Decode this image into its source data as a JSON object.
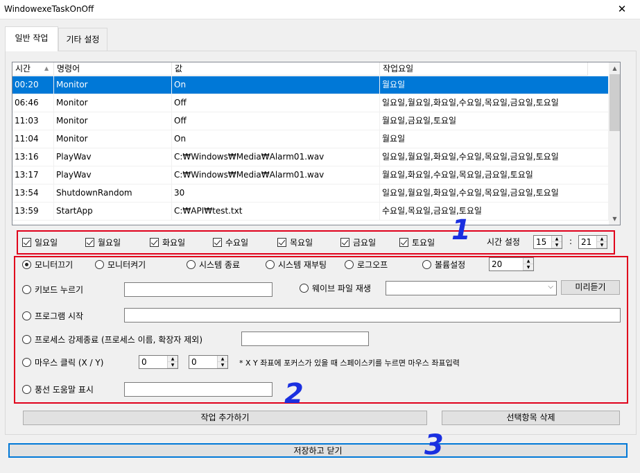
{
  "window": {
    "title": "WindowexeTaskOnOff",
    "close_glyph": "✕"
  },
  "tabs": [
    {
      "label": "일반 작업"
    },
    {
      "label": "기타 설정"
    }
  ],
  "list": {
    "columns": [
      "시간",
      "명령어",
      "값",
      "작업요일"
    ],
    "rows": [
      {
        "time": "00:20",
        "command": "Monitor",
        "value": "On",
        "days": "월요일"
      },
      {
        "time": "06:46",
        "command": "Monitor",
        "value": "Off",
        "days": "일요일,월요일,화요일,수요일,목요일,금요일,토요일"
      },
      {
        "time": "11:03",
        "command": "Monitor",
        "value": "Off",
        "days": "월요일,금요일,토요일"
      },
      {
        "time": "11:04",
        "command": "Monitor",
        "value": "On",
        "days": "월요일"
      },
      {
        "time": "13:16",
        "command": "PlayWav",
        "value": "C:₩Windows₩Media₩Alarm01.wav",
        "days": "일요일,월요일,화요일,수요일,목요일,금요일,토요일"
      },
      {
        "time": "13:17",
        "command": "PlayWav",
        "value": "C:₩Windows₩Media₩Alarm01.wav",
        "days": "월요일,화요일,수요일,목요일,금요일,토요일"
      },
      {
        "time": "13:54",
        "command": "ShutdownRandom",
        "value": "30",
        "days": "일요일,월요일,화요일,수요일,목요일,금요일,토요일"
      },
      {
        "time": "13:59",
        "command": "StartApp",
        "value": "C:₩API₩test.txt",
        "days": "수요일,목요일,금요일,토요일"
      }
    ],
    "selected_index": 0
  },
  "days": {
    "items": [
      "일요일",
      "월요일",
      "화요일",
      "수요일",
      "목요일",
      "금요일",
      "토요일"
    ],
    "time_label": "시간 설정",
    "hour": "15",
    "minute": "21",
    "separator": ":"
  },
  "options": {
    "monitor_off": "모니터끄기",
    "monitor_on": "모니터켜기",
    "shutdown": "시스템 종료",
    "reboot": "시스템 재부팅",
    "logoff": "로그오프",
    "volume": "볼륨설정",
    "volume_value": "20",
    "keyboard": "키보드 누르기",
    "wave": "웨이브 파일 재생",
    "preview": "미리듣기",
    "start_program": "프로그램 시작",
    "kill_process": "프로세스 강제종료 (프로세스 이름, 확장자 제외)",
    "mouse_click": "마우스 클릭 (X / Y)",
    "mouse_x": "0",
    "mouse_y": "0",
    "mouse_hint": "* X Y 좌표에 포커스가 있을 때 스페이스키를 누르면 마우스 좌표입력",
    "balloon": "풍선 도움말 표시"
  },
  "buttons": {
    "add_task": "작업 추가하기",
    "delete_selected": "선택항목 삭제",
    "save_close": "저장하고 닫기"
  },
  "annotations": [
    "1",
    "2",
    "3"
  ],
  "colors": {
    "selection": "#0078d7",
    "annotation_box": "#e0001b",
    "annotation_number": "#1a2fe0"
  }
}
